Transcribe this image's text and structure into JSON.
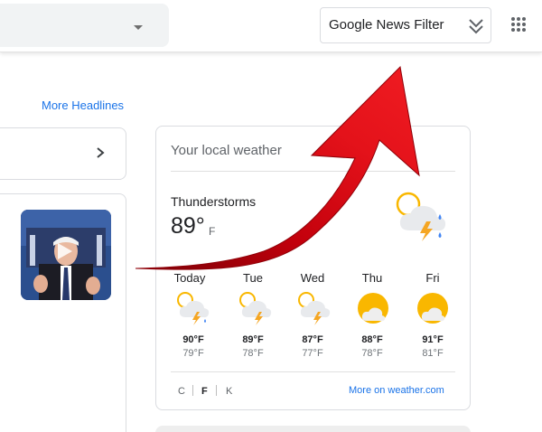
{
  "toolbar": {
    "extension_button_label": "Google News Filter",
    "extension_icon": "chevron-double-down-icon",
    "apps_icon": "apps-grid-icon"
  },
  "headlines": {
    "more_label": "More Headlines"
  },
  "weather": {
    "title": "Your local weather",
    "current": {
      "condition": "Thunderstorms",
      "temp": "89°",
      "unit": "F",
      "icon": "thunderstorm-icon"
    },
    "forecast": [
      {
        "day": "Today",
        "hi": "90°F",
        "lo": "79°F",
        "icon": "thunderstorm-icon"
      },
      {
        "day": "Tue",
        "hi": "89°F",
        "lo": "78°F",
        "icon": "thunderstorm-icon"
      },
      {
        "day": "Wed",
        "hi": "87°F",
        "lo": "77°F",
        "icon": "thunderstorm-icon"
      },
      {
        "day": "Thu",
        "hi": "88°F",
        "lo": "78°F",
        "icon": "partly-sunny-icon"
      },
      {
        "day": "Fri",
        "hi": "91°F",
        "lo": "81°F",
        "icon": "partly-sunny-icon"
      }
    ],
    "units": [
      "C",
      "F",
      "K"
    ],
    "selected_unit": "F",
    "more_link": "More on weather.com"
  },
  "colors": {
    "accent_link": "#1a73e8",
    "arrow_red": "#e00d14",
    "arrow_dark": "#8f0008",
    "sun": "#f9b700",
    "bolt": "#f5a623",
    "rain": "#4285f4"
  }
}
